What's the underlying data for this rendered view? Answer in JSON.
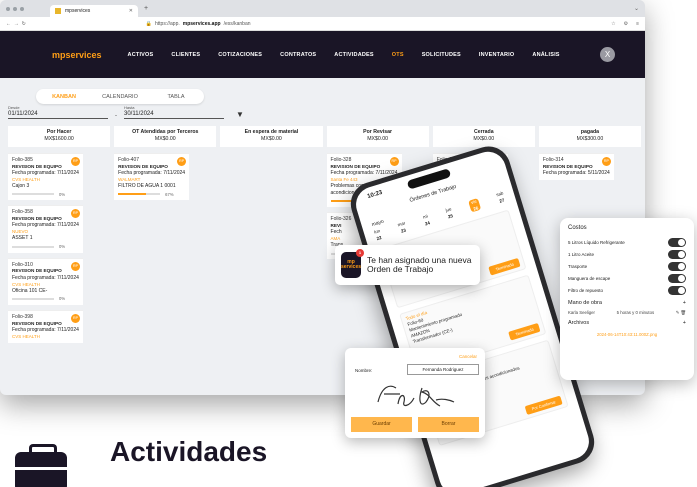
{
  "browser": {
    "tab_title": "mpservices",
    "url_prefix": "https://app.",
    "url_domain": "mpservices.app",
    "url_path": "/ess/kanban"
  },
  "nav": {
    "brand": "mpservices",
    "items": [
      "ACTIVOS",
      "CLIENTES",
      "COTIZACIONES",
      "CONTRATOS",
      "ACTIVIDADES",
      "OTS",
      "SOLICITUDES",
      "INVENTARIO",
      "ANÁLISIS"
    ],
    "active": "OTS",
    "avatar": "X"
  },
  "views": {
    "kanban": "KANBAN",
    "calendario": "CALENDARIO",
    "tabla": "TABLA"
  },
  "filters": {
    "desde_label": "Desde",
    "desde": "01/11/2024",
    "hasta_label": "Hasta",
    "hasta": "30/11/2024",
    "sep": "-"
  },
  "columns": [
    {
      "name": "Por Hacer",
      "total": "MX$1600.00"
    },
    {
      "name": "OT Atendidas por Terceros",
      "total": "MX$0.00"
    },
    {
      "name": "En espera de material",
      "total": "MX$0.00"
    },
    {
      "name": "Por Revisar",
      "total": "MX$0.00"
    },
    {
      "name": "Cerrada",
      "total": "MX$0.00"
    },
    {
      "name": "pagada",
      "total": "MX$300.00"
    }
  ],
  "cards_col1": [
    {
      "folio": "Folio-385",
      "title": "REVISION DE EQUIPO",
      "date": "Fecha programada: 7/11/2024",
      "client": "CVS HEALTH",
      "asset": "Cajon 3",
      "progress": "0%",
      "pct": 0,
      "badge": "RP"
    },
    {
      "folio": "Folio-358",
      "title": "REVISION DE EQUIPO",
      "date": "Fecha programada: 7/11/2024",
      "client": "NUEVO",
      "asset": "ASSET 1",
      "progress": "0%",
      "pct": 0,
      "badge": "RP"
    },
    {
      "folio": "Folio-310",
      "title": "REVISION DE EQUIPO",
      "date": "Fecha programada: 7/11/2024",
      "client": "CVS HEALTH",
      "asset": "Oficina 101 CE-",
      "progress": "0%",
      "pct": 0,
      "badge": "RP"
    },
    {
      "folio": "Folio-398",
      "title": "REVISION DE EQUIPO",
      "date": "Fecha programada: 7/11/2024",
      "client": "CVS HEALTH",
      "asset": "",
      "progress": "",
      "pct": 0,
      "badge": "RP"
    }
  ],
  "cards_col2": [
    {
      "folio": "Folio-407",
      "title": "REVISION DE EQUIPO",
      "date": "Fecha programada: 7/11/2024",
      "client": "WALMART",
      "asset": "FILTRO DE AGUA 1 0001",
      "progress": "67%",
      "pct": 67,
      "badge": "RP"
    }
  ],
  "cards_col4": [
    {
      "folio": "Folio-328",
      "title": "REVISION DE EQUIPO",
      "date": "Fecha programada: 7/11/2024",
      "client": "Santa Fe 443",
      "asset": "Problemas con el aire acondicionado",
      "progress": "100%",
      "pct": 100,
      "badge": "RP"
    },
    {
      "folio": "Folio-326",
      "title": "REVI",
      "date": "Fech",
      "client": "AMA",
      "asset": "Trans",
      "progress": "0%",
      "pct": 0,
      "badge": ""
    }
  ],
  "cards_col5": [
    {
      "folio": "Folio-363",
      "title": "REVISI",
      "date": "Fech",
      "client": "ATO",
      "asset": "Mini",
      "progress": "",
      "pct": 0,
      "badge": ""
    }
  ],
  "cards_col6": [
    {
      "folio": "Folio-314",
      "title": "REVISION DE EQUIPO",
      "date": "Fecha programada: 5/11/2024",
      "client": "",
      "asset": "",
      "progress": "",
      "pct": 0,
      "badge": "RP"
    }
  ],
  "phone": {
    "time": "10:23",
    "title": "Órdenes de Trabajo",
    "month": "mayo",
    "days": [
      [
        "lun",
        "22"
      ],
      [
        "mar",
        "23"
      ],
      [
        "mi",
        "24"
      ],
      [
        "jue",
        "25"
      ],
      [
        "vie",
        "26"
      ],
      [
        "sab",
        "27"
      ]
    ],
    "card1": {
      "label": "Todo el día",
      "folio": "Folio-61",
      "desc": "Reparación de Split",
      "client": "ALKIRERA",
      "asset": "Tienda Soldera (CE-AWB)",
      "btn": "Terminada"
    },
    "card2": {
      "label": "Todo el día",
      "folio": "Folio-60",
      "desc": "Mantenimiento programado",
      "client": "AMAZON",
      "asset": "Transformador (CE-)",
      "btn": "Terminada"
    },
    "card3": {
      "label": "Todo el día",
      "folio": "Folio-57",
      "desc": "Mantenimiento Trimestral Aires acondicionados",
      "client": "APPLE",
      "asset": "Mini Split (MS-229)",
      "btn": "Por Confirmar"
    }
  },
  "costos": {
    "title": "Costos",
    "items": [
      "5 Litros Líquido Refrigerante",
      "1 Litro Aceite",
      "Trasporte",
      "Manguera de escape",
      "Filtro de repuesto"
    ],
    "labor_title": "Mano de obra",
    "tech": "Karla Seeliger",
    "tech_time": "5 horas y 0 minutos",
    "files_title": "Archivos",
    "file": "2024-06-14T10:43:11.000Z.png"
  },
  "notification": {
    "logo": "mp services",
    "badge": "1",
    "text": "Te han asignado una nueva Orden de Trabajo"
  },
  "signature": {
    "cancel": "Cancelar",
    "name_label": "Nombre:",
    "name_value": "Fernanda Rodriguez",
    "save": "Guardar",
    "erase": "Borrar"
  },
  "headline": "Actividades"
}
